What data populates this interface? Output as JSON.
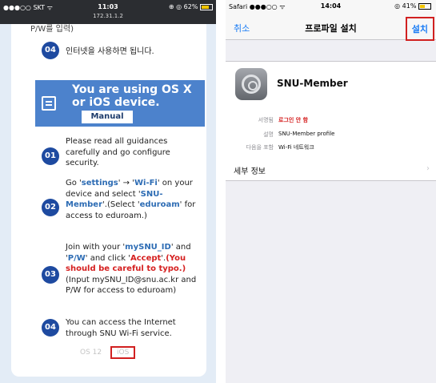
{
  "left": {
    "status": {
      "carrier": "●●●○○ SKT ᯤ",
      "time": "11:03",
      "address": "172.31.1.2",
      "battery": "⊕ ◎ 62%"
    },
    "steps_top": {
      "num": "04",
      "cut_text": "P/W를 입력)",
      "text": "인터넷을 사용하면 됩니다."
    },
    "banner": {
      "title": "You are using OS X or iOS device.",
      "manual": "Manual"
    },
    "steps": [
      {
        "num": "01",
        "text": "Please read all guidances carefully and go configure security."
      },
      {
        "num": "02",
        "parts": [
          "Go '",
          "settings",
          "' → '",
          "Wi-Fi",
          "' on your device and select '",
          "SNU-Member",
          "'.(Select '",
          "eduroam",
          "' for access to eduroam.)"
        ]
      },
      {
        "num": "03",
        "parts": [
          "Join with your '",
          "mySNU_ID",
          "' and '",
          "P/W",
          "' and click '",
          "Accept",
          "'.",
          "(You should be careful to typo.)",
          "(Input mySNU_ID@snu.ac.kr and P/W for access to eduroam)"
        ]
      },
      {
        "num": "04",
        "text": "You can access the Internet through SNU Wi-Fi service."
      }
    ],
    "pager": {
      "prev": "OS 12",
      "current": "iOS"
    }
  },
  "right": {
    "status": {
      "left": "Safari ●●●○○ ᯤ",
      "time": "14:04",
      "battery": "◎ 41%"
    },
    "nav": {
      "cancel": "취소",
      "title": "프로파일 설치",
      "install": "설치"
    },
    "profile": {
      "name": "SNU-Member",
      "rows": [
        {
          "k": "서명됨",
          "v": "로그인 안 함"
        },
        {
          "k": "설명",
          "v": "SNU-Member profile"
        },
        {
          "k": "다음을 포함",
          "v": "Wi-Fi 네트워크"
        }
      ],
      "detail": "세부 정보",
      "chevron": "›"
    }
  }
}
